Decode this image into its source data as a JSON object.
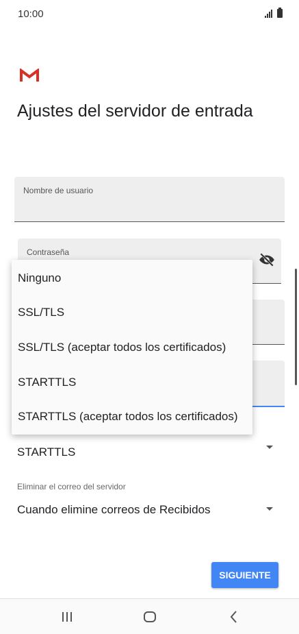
{
  "status_bar": {
    "time": "10:00"
  },
  "page": {
    "title": "Ajustes del servidor de entrada"
  },
  "form": {
    "username": {
      "label": "Nombre de usuario",
      "value": ""
    },
    "password": {
      "label": "Contraseña",
      "value": ""
    },
    "security": {
      "selected": "STARTTLS"
    },
    "delete_policy": {
      "label": "Eliminar el correo del servidor",
      "selected": "Cuando elimine correos de Recibidos"
    }
  },
  "security_menu": {
    "options": [
      "Ninguno",
      "SSL/TLS",
      "SSL/TLS (aceptar todos los certificados)",
      "STARTTLS",
      "STARTTLS (aceptar todos los certificados)"
    ]
  },
  "actions": {
    "next_label": "SIGUIENTE"
  },
  "colors": {
    "accent": "#4285f4",
    "gmail_red": "#d93025"
  }
}
